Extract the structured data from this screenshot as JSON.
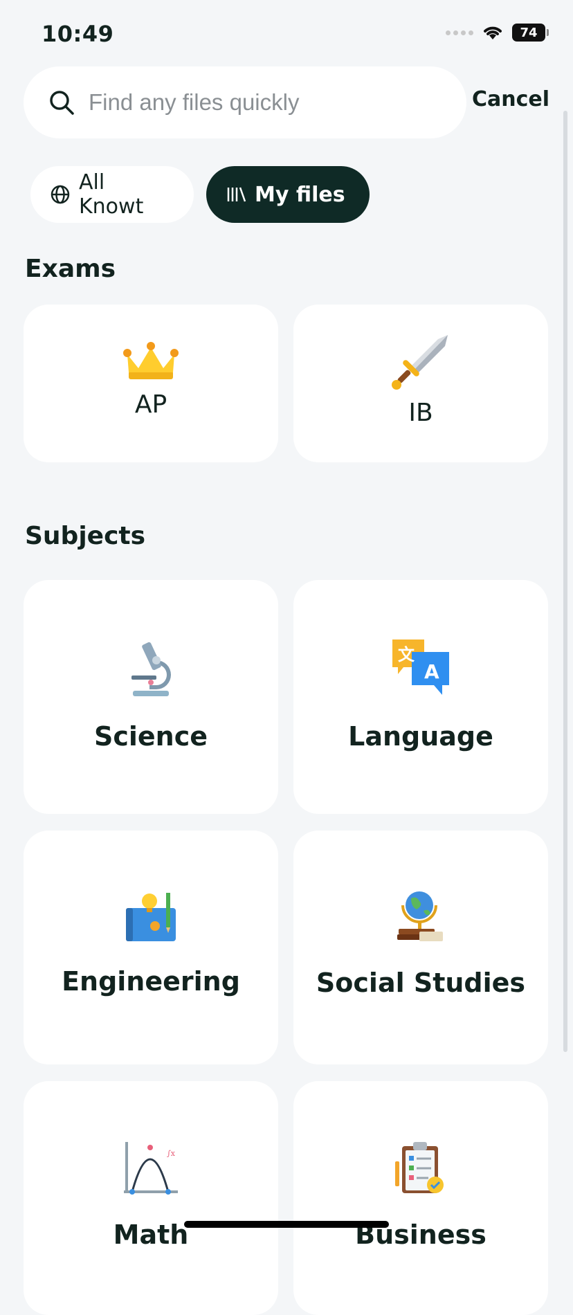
{
  "status_bar": {
    "time": "10:49",
    "battery": "74"
  },
  "search": {
    "placeholder": "Find any files quickly",
    "cancel_label": "Cancel"
  },
  "filters": {
    "all_label": "All Knowt",
    "mine_label": "My files"
  },
  "exams": {
    "title": "Exams",
    "items": [
      {
        "label": "AP",
        "icon": "crown-icon"
      },
      {
        "label": "IB",
        "icon": "sword-icon"
      }
    ]
  },
  "subjects": {
    "title": "Subjects",
    "items": [
      {
        "label": "Science",
        "icon": "microscope-icon"
      },
      {
        "label": "Language",
        "icon": "translate-icon"
      },
      {
        "label": "Engineering",
        "icon": "blueprint-icon"
      },
      {
        "label": "Social Studies",
        "icon": "globe-icon"
      },
      {
        "label": "Math",
        "icon": "graph-icon"
      },
      {
        "label": "Business",
        "icon": "clipboard-icon"
      }
    ]
  },
  "colors": {
    "accent_dark": "#0f2a26",
    "background": "#f4f6f8",
    "card": "#ffffff"
  }
}
